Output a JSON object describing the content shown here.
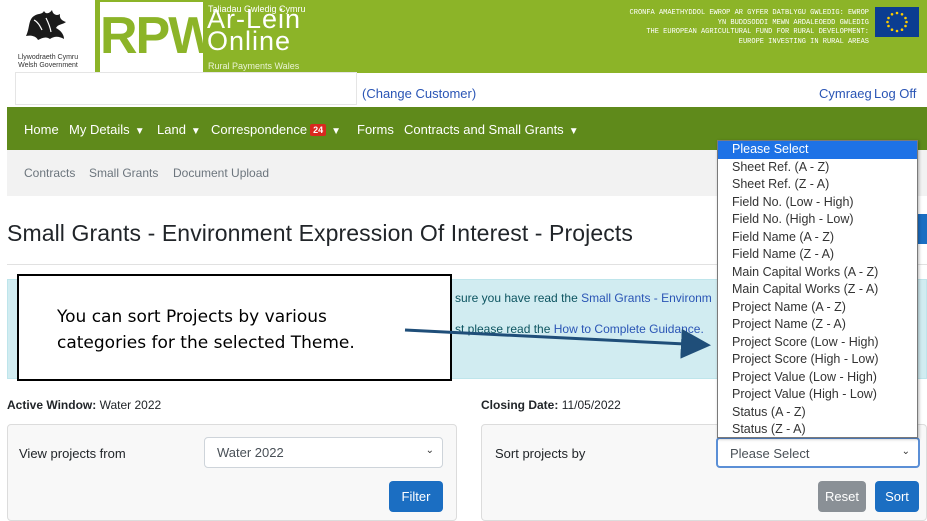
{
  "header": {
    "gov_text": "Llywodraeth Cymru\nWelsh Government",
    "logo": "RPW",
    "service_tagline_top": "Taliadau Gwledig Cymru",
    "service_title": "Ar-Lein\nOnline",
    "service_tagline_bottom": "Rural Payments Wales",
    "eu_text": "CRONFA AMAETHYDDOL EWROP AR GYFER DATBLYGU GWLEDIG: EWROP YN BUDDSODDI MEWN ARDALEOEDD GWLEDIG\nTHE EUROPEAN AGRICULTURAL FUND FOR RURAL DEVELOPMENT: EUROPE INVESTING IN RURAL AREAS",
    "colors": {
      "banner": "#8cb428",
      "nav": "#5f8a1b",
      "eu_flag": "#0b3d91"
    }
  },
  "customer_bar": {
    "change_customer": "(Change Customer)",
    "language_link": "Cymraeg",
    "logoff_link": "Log Off"
  },
  "nav": {
    "items": [
      {
        "label": "Home",
        "has_menu": false
      },
      {
        "label": "My Details",
        "has_menu": true
      },
      {
        "label": "Land",
        "has_menu": true
      },
      {
        "label": "Correspondence",
        "has_menu": true,
        "badge": "24"
      },
      {
        "label": "Forms",
        "has_menu": false
      },
      {
        "label": "Contracts and Small Grants",
        "has_menu": true
      }
    ]
  },
  "subnav": {
    "items": [
      "Contracts",
      "Small Grants",
      "Document Upload"
    ]
  },
  "page": {
    "title": "Small Grants - Environment Expression Of Interest - Projects"
  },
  "info": {
    "line1_prefix": "sure you have read the ",
    "line1_link": "Small Grants - Environm",
    "line2_prefix": "st please read the ",
    "line2_link": "How to Complete Guidance."
  },
  "callout": {
    "text": "You can sort Projects by various categories for the selected Theme."
  },
  "window_info": {
    "active_label": "Active Window:",
    "active_value": "Water 2022",
    "closing_label": "Closing Date:",
    "closing_value": "11/05/2022"
  },
  "filter_card": {
    "label": "View projects from",
    "selected": "Water 2022",
    "button": "Filter"
  },
  "sort_card": {
    "label": "Sort projects by",
    "selected": "Please Select",
    "reset_button": "Reset",
    "sort_button": "Sort",
    "options": [
      "Please Select",
      "Sheet Ref. (A - Z)",
      "Sheet Ref. (Z - A)",
      "Field No. (Low - High)",
      "Field No. (High - Low)",
      "Field Name (A - Z)",
      "Field Name (Z - A)",
      "Main Capital Works (A - Z)",
      "Main Capital Works (Z - A)",
      "Project Name (A - Z)",
      "Project Name (Z - A)",
      "Project Score (Low - High)",
      "Project Score (High - Low)",
      "Project Value (Low - High)",
      "Project Value (High - Low)",
      "Status (A - Z)",
      "Status (Z - A)"
    ]
  }
}
